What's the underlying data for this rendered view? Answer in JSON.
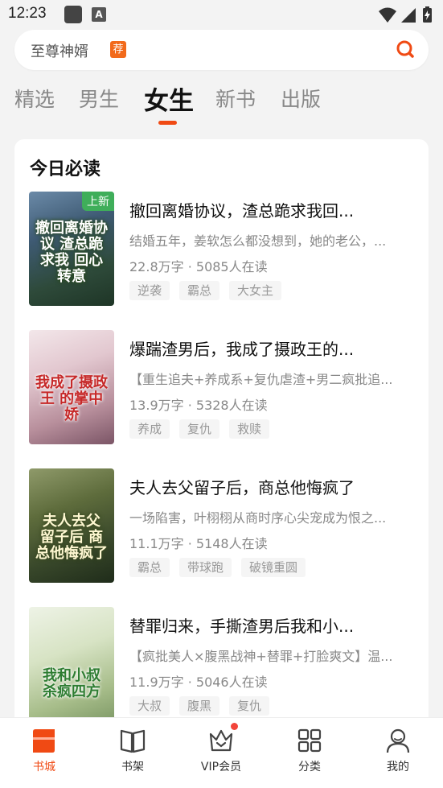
{
  "status_bar": {
    "time": "12:23"
  },
  "search": {
    "placeholder_text": "至尊神婿",
    "badge": "荐"
  },
  "tabs": [
    {
      "label": "精选",
      "active": false
    },
    {
      "label": "男生",
      "active": false
    },
    {
      "label": "女生",
      "active": true
    },
    {
      "label": "新书",
      "active": false
    },
    {
      "label": "出版",
      "active": false
    }
  ],
  "section": {
    "title": "今日必读"
  },
  "books": [
    {
      "title": "撤回离婚协议，渣总跪求我回...",
      "description": "结婚五年，姜软怎么都没想到，她的老公，...",
      "meta": "22.8万字 · 5085人在读",
      "tags": [
        "逆袭",
        "霸总",
        "大女主"
      ],
      "cover_text": "撤回离婚协议 渣总跪求我 回心转意",
      "cover_badge": "上新"
    },
    {
      "title": "爆踹渣男后，我成了摄政王的...",
      "description": "【重生追夫+养成系+复仇虐渣+男二疯批追...",
      "meta": "13.9万字 · 5328人在读",
      "tags": [
        "养成",
        "复仇",
        "救赎"
      ],
      "cover_text": "我成了摄政王 的掌中娇",
      "cover_badge": ""
    },
    {
      "title": "夫人去父留子后，商总他悔疯了",
      "description": "一场陷害，叶栩栩从商时序心尖宠成为恨之...",
      "meta": "11.1万字 · 5148人在读",
      "tags": [
        "霸总",
        "带球跑",
        "破镜重圆"
      ],
      "cover_text": "夫人去父 留子后 商总他悔疯了",
      "cover_badge": ""
    },
    {
      "title": "替罪归来，手撕渣男后我和小...",
      "description": "【疯批美人×腹黑战神+替罪+打脸爽文】温...",
      "meta": "11.9万字 · 5046人在读",
      "tags": [
        "大叔",
        "腹黑",
        "复仇"
      ],
      "cover_text": "我和小叔 杀疯四方",
      "cover_badge": ""
    }
  ],
  "bottom_nav": [
    {
      "label": "书城",
      "icon": "bookstore-icon",
      "active": true
    },
    {
      "label": "书架",
      "icon": "bookshelf-icon",
      "active": false
    },
    {
      "label": "VIP会员",
      "icon": "vip-crown-icon",
      "active": false,
      "dot": true
    },
    {
      "label": "分类",
      "icon": "category-grid-icon",
      "active": false
    },
    {
      "label": "我的",
      "icon": "profile-icon",
      "active": false
    }
  ],
  "colors": {
    "accent": "#f04a14",
    "badge_orange": "#f26a1b",
    "new_badge_green": "#3fae5a",
    "dot_red": "#f2443a"
  }
}
